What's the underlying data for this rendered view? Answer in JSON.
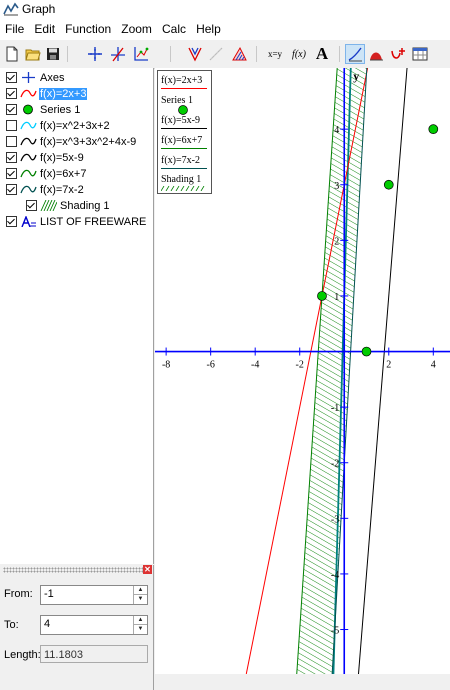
{
  "window": {
    "title": "Graph",
    "icon": "graph-app-icon"
  },
  "menu": [
    "File",
    "Edit",
    "Function",
    "Zoom",
    "Calc",
    "Help"
  ],
  "toolbar": {
    "buttons": [
      "new-document",
      "open-folder",
      "save",
      "insert-axes",
      "insert-function-axes",
      "insert-point-series",
      "insert-relation",
      "insert-tangent",
      "insert-shading",
      "xy-evaluate",
      "fx-label",
      "insert-text",
      "trace-curve",
      "area",
      "insert-custom",
      "table"
    ],
    "fx_label": "f(x)",
    "xy_label": "x=y",
    "text_label": "A",
    "active": "trace-curve"
  },
  "tree": [
    {
      "label": "Axes",
      "checked": true,
      "icon": "axes-icon",
      "indent": 0
    },
    {
      "label": "f(x)=2x+3",
      "checked": true,
      "icon": "curve-icon",
      "color": "#ff0000",
      "indent": 0,
      "selected": true
    },
    {
      "label": "Series 1",
      "checked": true,
      "icon": "point-icon",
      "color": "#00cc00",
      "indent": 0
    },
    {
      "label": "f(x)=x^2+3x+2",
      "checked": false,
      "icon": "curve-icon",
      "color": "#00ccff",
      "indent": 0
    },
    {
      "label": "f(x)=x^3+3x^2+4x-9",
      "checked": false,
      "icon": "curve-icon",
      "color": "#000000",
      "indent": 0
    },
    {
      "label": "f(x)=5x-9",
      "checked": true,
      "icon": "curve-icon",
      "color": "#000000",
      "indent": 0
    },
    {
      "label": "f(x)=6x+7",
      "checked": true,
      "icon": "curve-icon",
      "color": "#008000",
      "indent": 0
    },
    {
      "label": "f(x)=7x-2",
      "checked": true,
      "icon": "curve-icon",
      "color": "#005050",
      "indent": 0
    },
    {
      "label": "Shading 1",
      "checked": true,
      "icon": "shading-icon",
      "color": "#008000",
      "indent": 1
    },
    {
      "label": "LIST OF FREEWARE",
      "checked": true,
      "icon": "text-label-icon",
      "color": "#0000cc",
      "indent": 0
    }
  ],
  "panel": {
    "from_label": "From:",
    "from_value": "-1",
    "to_label": "To:",
    "to_value": "4",
    "length_label": "Length:",
    "length_value": "11.1803"
  },
  "legend": [
    {
      "label": "f(x)=2x+3",
      "color": "#ff0000"
    },
    {
      "label": "Series 1",
      "color": "#00cc00"
    },
    {
      "label": "f(x)=5x-9",
      "color": "#000000"
    },
    {
      "label": "f(x)=6x+7",
      "color": "#008000"
    },
    {
      "label": "f(x)=7x-2",
      "color": "#005050"
    },
    {
      "label": "Shading 1",
      "color": "#008000"
    }
  ],
  "plot": {
    "axis_color": "#0000ff",
    "y_axis_label": "y",
    "x_ticks": [
      "-8",
      "-6",
      "-4",
      "-2",
      "2",
      "4"
    ],
    "y_ticks": [
      "4",
      "3",
      "2",
      "1",
      "-1",
      "-2",
      "-3",
      "-4",
      "-5"
    ],
    "xlim": [
      -8.5,
      4.75
    ],
    "ylim": [
      -5.8,
      5.1
    ],
    "functions": [
      {
        "name": "f(x)=2x+3",
        "slope": 2,
        "intercept": 3,
        "color": "#ff0000"
      },
      {
        "name": "f(x)=5x-9",
        "slope": 5,
        "intercept": -9,
        "color": "#000000"
      },
      {
        "name": "f(x)=6x+7",
        "slope": 6,
        "intercept": 7,
        "color": "#008000"
      },
      {
        "name": "f(x)=7x-2",
        "slope": 7,
        "intercept": -2,
        "color": "#005050"
      }
    ],
    "series_points": [
      [
        -1,
        1
      ],
      [
        1,
        0
      ],
      [
        2,
        3
      ],
      [
        4,
        4
      ]
    ],
    "series_color": "#00cc00",
    "tangent": {
      "slope": 14,
      "intercept": 1,
      "color": "#008080"
    },
    "shading": {
      "color": "#008000",
      "between": "f(x)=6x+7 and f(x)=7x-2"
    }
  }
}
